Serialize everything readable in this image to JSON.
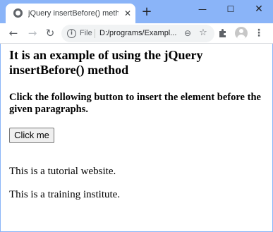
{
  "browser": {
    "tab_title": "jQuery insertBefore() method",
    "tab_close": "✕",
    "new_tab": "+",
    "window_minimize": "—",
    "window_maximize": "☐",
    "window_close": "✕",
    "back_icon": "←",
    "forward_icon": "→",
    "reload_icon": "↻",
    "info_icon_glyph": "i",
    "scheme_label": "File",
    "url": "D:/programs/Exampl...",
    "zoom_icon": "⊖",
    "star_icon": "☆",
    "menu_icon": "⋮",
    "accent_color": "#8ab4f8"
  },
  "page": {
    "heading": "It is an example of using the jQuery insertBefore() method",
    "subheading": "Click the following button to insert the element before the given paragraphs.",
    "button_label": "Click me",
    "paragraphs": [
      "This is a tutorial website.",
      "This is a training institute."
    ]
  }
}
